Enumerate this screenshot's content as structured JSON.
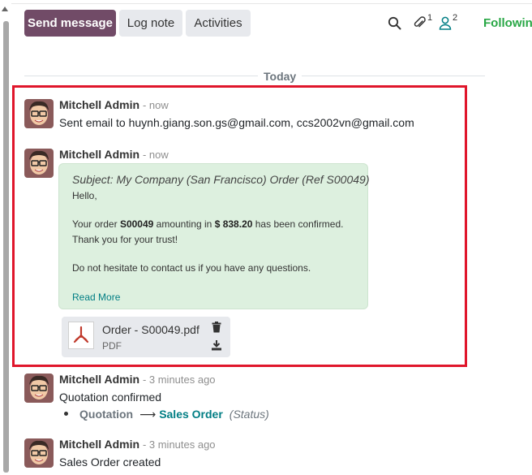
{
  "toolbar": {
    "send_message": "Send message",
    "log_note": "Log note",
    "activities": "Activities",
    "attachments_count": "1",
    "followers_count": "2",
    "following": "Following"
  },
  "day_separator": "Today",
  "messages": [
    {
      "author": "Mitchell Admin",
      "date": "- now",
      "body": "Sent email to huynh.giang.son.gs@gmail.com, ccs2002vn@gmail.com"
    },
    {
      "author": "Mitchell Admin",
      "date": "- now",
      "subject": "Subject: My Company (San Francisco) Order (Ref S00049)",
      "greeting": "Hello,",
      "order_prefix": "Your order ",
      "order_ref": "S00049",
      "amount_prefix": " amounting in ",
      "amount": "$ 838.20",
      "amount_suffix": " has been confirmed.",
      "thanks": "Thank you for your trust!",
      "contact": "Do not hesitate to contact us if you have any questions.",
      "read_more": "Read More",
      "attachment": {
        "name": "Order - S00049.pdf",
        "type": "PDF"
      }
    },
    {
      "author": "Mitchell Admin",
      "date": "- 3 minutes ago",
      "body": "Quotation confirmed",
      "tracking": {
        "old_value": "Quotation",
        "new_value": "Sales Order",
        "field": "(Status)"
      }
    },
    {
      "author": "Mitchell Admin",
      "date": "- 3 minutes ago",
      "body": "Sales Order created"
    }
  ],
  "colors": {
    "primary": "#714b67",
    "following": "#28a745",
    "link": "#017e84",
    "highlight_border": "#e0162b",
    "email_bubble": "#ddf0df"
  }
}
